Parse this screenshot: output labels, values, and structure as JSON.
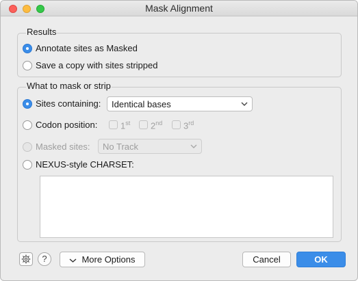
{
  "window": {
    "title": "Mask Alignment"
  },
  "results": {
    "legend": "Results",
    "options": [
      {
        "label": "Annotate sites as Masked",
        "selected": true
      },
      {
        "label": "Save a copy with sites stripped",
        "selected": false
      }
    ]
  },
  "mask": {
    "legend": "What to mask or strip",
    "sites_containing": {
      "label": "Sites containing:",
      "selected": true,
      "value": "Identical bases"
    },
    "codon_position": {
      "label": "Codon position:",
      "selected": false,
      "positions": [
        {
          "num": "1",
          "suffix": "st"
        },
        {
          "num": "2",
          "suffix": "nd"
        },
        {
          "num": "3",
          "suffix": "rd"
        }
      ]
    },
    "masked_sites": {
      "label": "Masked sites:",
      "enabled": false,
      "value": "No Track"
    },
    "charset": {
      "label": "NEXUS-style CHARSET:",
      "selected": false,
      "value": ""
    }
  },
  "footer": {
    "help": "?",
    "more_options": "More Options",
    "cancel": "Cancel",
    "ok": "OK"
  },
  "colors": {
    "accent": "#3b8de8",
    "window_bg": "#ececec"
  }
}
